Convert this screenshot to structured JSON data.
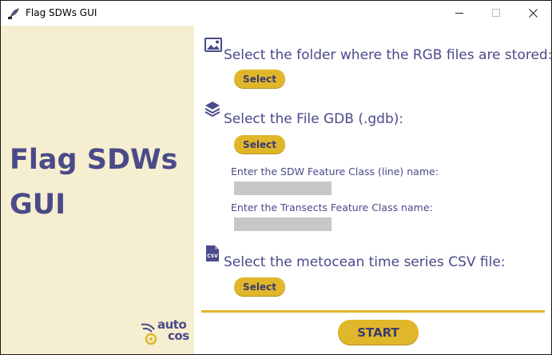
{
  "window": {
    "title": "Flag SDWs GUI",
    "minimize_icon": "minimize-icon",
    "maximize_icon": "maximize-icon",
    "close_icon": "close-icon"
  },
  "sidebar": {
    "title": "Flag SDWs\nGUI",
    "logo_text_top": "auto",
    "logo_text_bottom": "cos"
  },
  "sections": {
    "rgb": {
      "icon": "image-icon",
      "label": "Select the folder where the RGB files are stored:",
      "button": "Select"
    },
    "gdb": {
      "icon": "layers-icon",
      "label": "Select the File GDB (.gdb):",
      "button": "Select",
      "sdw_label": "Enter the SDW Feature Class (line) name:",
      "sdw_value": "",
      "transects_label": "Enter the Transects Feature Class name:",
      "transects_value": ""
    },
    "csv": {
      "icon": "csv-file-icon",
      "icon_text": "CSV",
      "label": "Select the metocean time series CSV file:",
      "button": "Select"
    }
  },
  "start_button": "START",
  "colors": {
    "accent": "#e0b72a",
    "text": "#4a4a8a",
    "sidebar_bg": "#f6eed0",
    "field_bg": "#c7c7c7"
  }
}
